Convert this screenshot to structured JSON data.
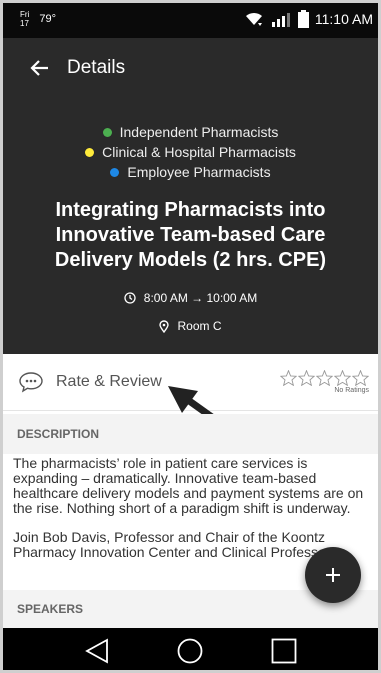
{
  "status_bar": {
    "day": "Fri",
    "date": "17",
    "temperature": "79°",
    "time": "11:10 AM"
  },
  "app_bar": {
    "title": "Details"
  },
  "session": {
    "tracks": [
      {
        "label": "Independent Pharmacists",
        "color": "#4caf50"
      },
      {
        "label": "Clinical & Hospital Pharmacists",
        "color": "#ffeb3b"
      },
      {
        "label": "Employee Pharmacists",
        "color": "#1e88e5"
      }
    ],
    "title": "Integrating Pharmacists into Innovative Team-based Care Delivery Models (2 hrs. CPE)",
    "time": "8:00 AM → 10:00 AM",
    "location": "Room C"
  },
  "rating": {
    "label": "Rate & Review",
    "no_ratings_label": "No Ratings",
    "stars": 0
  },
  "description": {
    "header": "DESCRIPTION",
    "paragraphs": [
      "The pharmacists’ role in patient care services is expanding – dramatically. Innovative team-based healthcare delivery models and payment systems are on the rise. Nothing short of a paradigm shift is underway.",
      "Join Bob Davis, Professor and Chair of the Koontz Pharmacy Innovation Center and Clinical Professor"
    ]
  },
  "speakers": {
    "header": "SPEAKERS"
  },
  "fab": {
    "icon": "plus-icon"
  },
  "colors": {
    "dark_bg": "#2a2a2a",
    "section_bg": "#f3f3f3"
  }
}
